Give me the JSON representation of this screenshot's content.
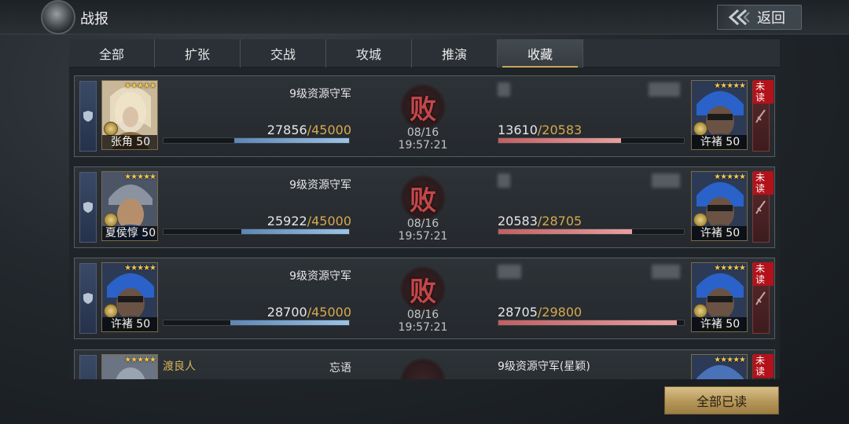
{
  "header": {
    "title": "战报",
    "back_label": "返回"
  },
  "tabs": [
    {
      "label": "全部"
    },
    {
      "label": "扩张"
    },
    {
      "label": "交战"
    },
    {
      "label": "攻城"
    },
    {
      "label": "推演"
    },
    {
      "label": "收藏",
      "active": true
    }
  ],
  "reports": [
    {
      "left_hero": {
        "name": "张角 50",
        "stars": "★★★★★"
      },
      "left_title": "9级资源守军",
      "left_troops_current": "27856",
      "left_troops_max": "/45000",
      "left_ratio": 0.62,
      "result": "败",
      "time": "08/16 19:57:21",
      "right_troops_current": "13610",
      "right_troops_max": "/20583",
      "right_ratio": 0.66,
      "right_hero": {
        "name": "许褚 50",
        "stars": "★★★★★"
      },
      "unread": "未读"
    },
    {
      "left_hero": {
        "name": "夏侯惇 50",
        "stars": "★★★★★"
      },
      "left_title": "9级资源守军",
      "left_troops_current": "25922",
      "left_troops_max": "/45000",
      "left_ratio": 0.58,
      "result": "败",
      "time": "08/16 19:57:21",
      "right_troops_current": "20583",
      "right_troops_max": "/28705",
      "right_ratio": 0.72,
      "right_hero": {
        "name": "许褚 50",
        "stars": "★★★★★"
      },
      "unread": "未读"
    },
    {
      "left_hero": {
        "name": "许褚 50",
        "stars": "★★★★★"
      },
      "left_title": "9级资源守军",
      "left_troops_current": "28700",
      "left_troops_max": "/45000",
      "left_ratio": 0.64,
      "result": "败",
      "time": "08/16 19:57:21",
      "right_troops_current": "28705",
      "right_troops_max": "/29800",
      "right_ratio": 0.96,
      "right_hero": {
        "name": "许褚 50",
        "stars": "★★★★★"
      },
      "unread": "未读"
    },
    {
      "left_player": "渡良人",
      "left_title": "忘语",
      "right_title": "9级资源守军(星颖)",
      "left_hero": {
        "stars": "★★★★★"
      },
      "right_hero": {
        "stars": "★★★★★"
      },
      "unread": "未读"
    }
  ],
  "footer": {
    "read_all_label": "全部已读"
  },
  "colors": {
    "accent_gold": "#d6a94e",
    "defeat_red": "#c4474a",
    "unread_red": "#b3121a"
  }
}
